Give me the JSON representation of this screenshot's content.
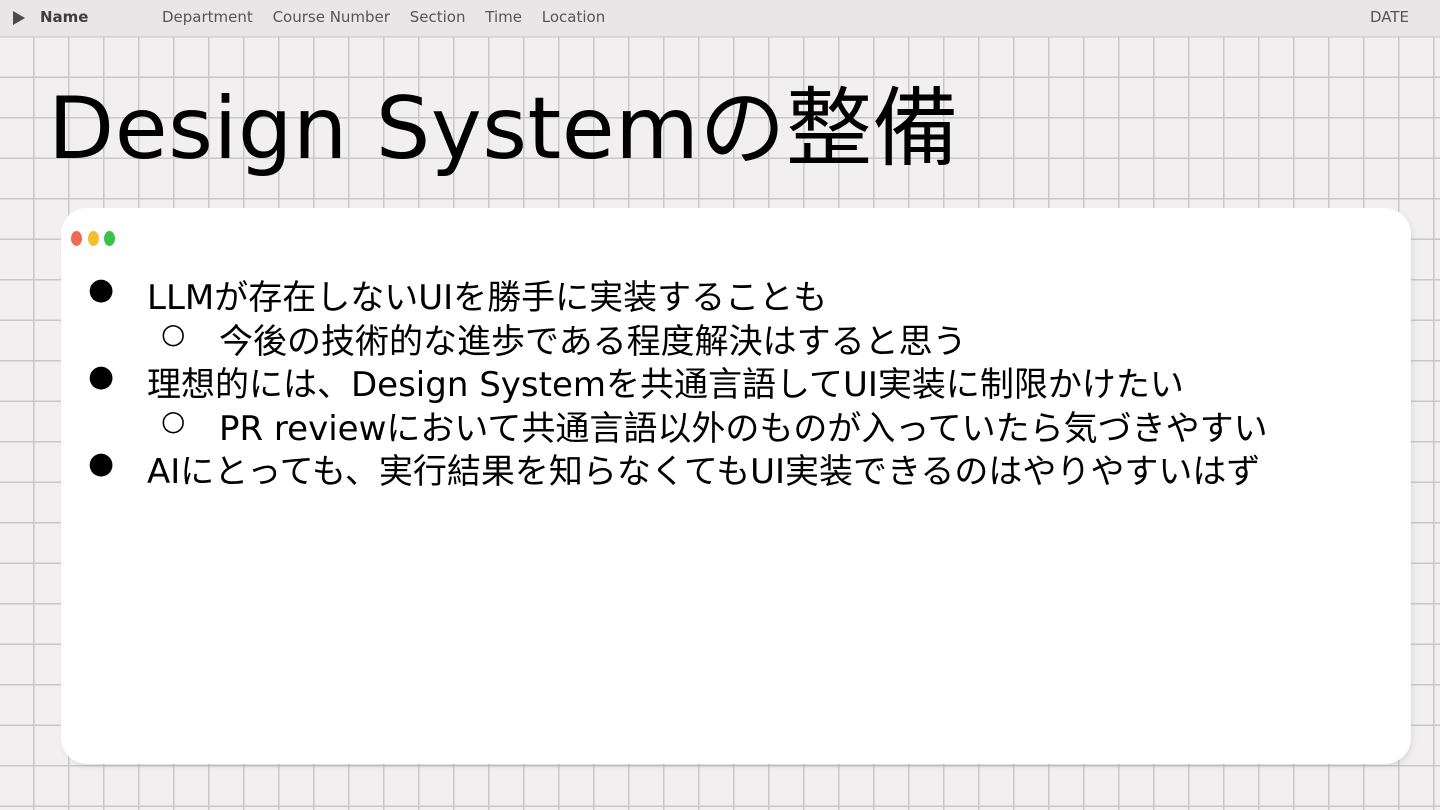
{
  "header": {
    "name_label": "Name",
    "fields": [
      "Department",
      "Course Number",
      "Section",
      "Time",
      "Location"
    ],
    "date_label": "DATE"
  },
  "slide": {
    "title": "Design Systemの整備",
    "bullets": [
      {
        "level": 1,
        "marker": "●",
        "text": "LLMが存在しないUIを勝手に実装することも"
      },
      {
        "level": 2,
        "marker": "○",
        "text": "今後の技術的な進歩である程度解決はすると思う"
      },
      {
        "level": 1,
        "marker": "●",
        "text": "理想的には、Design Systemを共通言語してUI実装に制限かけたい"
      },
      {
        "level": 2,
        "marker": "○",
        "text": "PR reviewにおいて共通言語以外のものが入っていたら気づきやすい"
      },
      {
        "level": 1,
        "marker": "●",
        "text": "AIにとっても、実行結果を知らなくてもUI実装できるのはやりやすいはず"
      }
    ]
  },
  "colors": {
    "window_dot_red": "#ee6a54",
    "window_dot_yellow": "#f2bf2e",
    "window_dot_green": "#39c24b",
    "grid_line": "#c9c7c8",
    "background": "#f1eff0"
  }
}
